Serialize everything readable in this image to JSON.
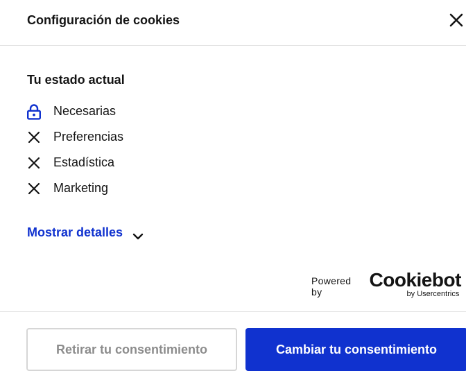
{
  "header": {
    "title": "Configuración de cookies"
  },
  "status": {
    "heading": "Tu estado actual",
    "items": [
      {
        "label": "Necesarias",
        "icon": "lock-icon"
      },
      {
        "label": "Preferencias",
        "icon": "x-icon"
      },
      {
        "label": "Estadística",
        "icon": "x-icon"
      },
      {
        "label": "Marketing",
        "icon": "x-icon"
      }
    ]
  },
  "details": {
    "label": "Mostrar detalles",
    "icon": "chevron-down-icon"
  },
  "footer": {
    "powered_by": "Powered by",
    "logo_text": "Cookiebot",
    "logo_sub": "by Usercentrics"
  },
  "actions": {
    "withdraw_label": "Retirar tu consentimiento",
    "change_label": "Cambiar tu consentimiento"
  },
  "colors": {
    "accent": "#1032cf",
    "text": "#141414",
    "disabled_text": "#8c8c8c",
    "divider": "#e0e0e0"
  }
}
